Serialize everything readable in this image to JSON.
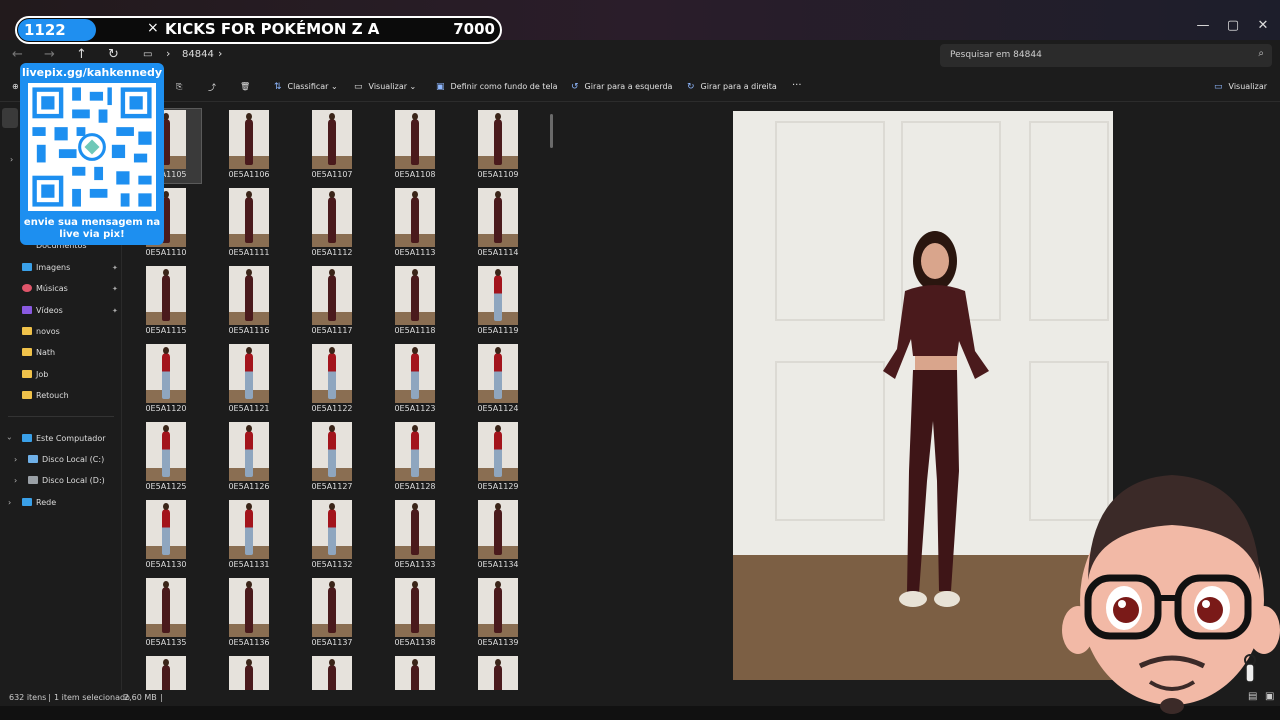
{
  "banner": {
    "count": "1122",
    "close": "×",
    "title": "KICKS FOR POKÉMON Z A",
    "goal": "7000"
  },
  "window": {
    "minimize": "—",
    "maximize": "▢",
    "close": "✕"
  },
  "address": {
    "back": "←",
    "forward": "→",
    "up": "↑",
    "refresh": "↻",
    "path_segment": "84844",
    "separator": "›",
    "search_placeholder": "Pesquisar em 84844",
    "search_icon": "⌕"
  },
  "toolbar": {
    "sort": "Classificar",
    "view": "Visualizar",
    "set_background": "Definir como fundo de tela",
    "rotate_left": "Girar para a esquerda",
    "rotate_right": "Girar para a direita",
    "more": "···",
    "preview": "Visualizar"
  },
  "sidebar": {
    "documents": "Documentos",
    "images": "Imagens",
    "music": "Músicas",
    "videos": "Vídeos",
    "novos": "novos",
    "nath": "Nath",
    "job": "Job",
    "retouch": "Retouch",
    "this_pc": "Este Computador",
    "disk_c": "Disco Local (C:)",
    "disk_d": "Disco Local (D:)",
    "network": "Rede",
    "pin": "📌",
    "chevron": "›"
  },
  "files": [
    "0E5A1105",
    "0E5A1106",
    "0E5A1107",
    "0E5A1108",
    "0E5A1109",
    "0E5A1110",
    "0E5A1111",
    "0E5A1112",
    "0E5A1113",
    "0E5A1114",
    "0E5A1115",
    "0E5A1116",
    "0E5A1117",
    "0E5A1118",
    "0E5A1119",
    "0E5A1120",
    "0E5A1121",
    "0E5A1122",
    "0E5A1123",
    "0E5A1124",
    "0E5A1125",
    "0E5A1126",
    "0E5A1127",
    "0E5A1128",
    "0E5A1129",
    "0E5A1130",
    "0E5A1131",
    "0E5A1132",
    "0E5A1133",
    "0E5A1134",
    "0E5A1135",
    "0E5A1136",
    "0E5A1137",
    "0E5A1138",
    "0E5A1139",
    "",
    "",
    "",
    "",
    ""
  ],
  "status": {
    "count": "632 itens",
    "selected": "1 item selecionado",
    "size": "2,60 MB"
  },
  "overlay": {
    "url": "livepix.gg/kahkennedy",
    "message_line1": "envie sua mensagem na",
    "message_line2": "live via pix!"
  },
  "colors": {
    "accent": "#1f8ff0",
    "outfit": "#4a1a1c",
    "red_top": "#a3141c",
    "jeans": "#8fa6bf"
  }
}
